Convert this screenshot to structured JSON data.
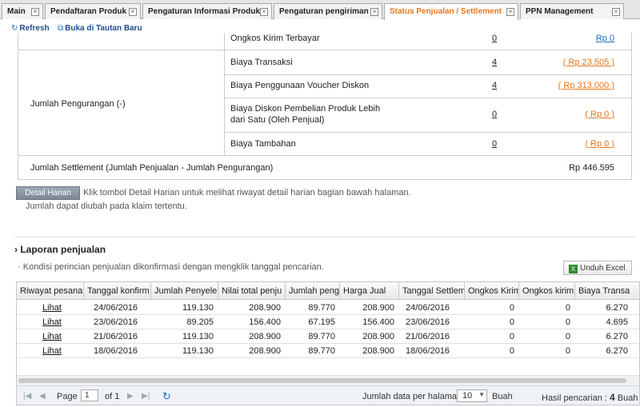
{
  "tabs": [
    {
      "label": "Main"
    },
    {
      "label": "Pendaftaran Produk"
    },
    {
      "label": "Pengaturan Informasi Produk"
    },
    {
      "label": "Pengaturan pengiriman"
    },
    {
      "label": "Status Penjualan / Settlement"
    },
    {
      "label": "PPN Management"
    }
  ],
  "toolbar": {
    "refresh": "Refresh",
    "open_new": "Buka di Tautan Baru"
  },
  "summary": {
    "group_label": "Jumlah Pengurangan (-)",
    "rows": [
      {
        "label": "Ongkos Kirim Terbayar",
        "count": "0",
        "amount": "Rp 0"
      },
      {
        "label": "Biaya Transaksi",
        "count": "4",
        "amount": "( Rp 23.505 )"
      },
      {
        "label": "Biaya Penggunaan Voucher Diskon",
        "count": "4",
        "amount": "( Rp 313.000 )"
      },
      {
        "label": "Biaya Diskon Pembelian Produk Lebih",
        "label2": "dari Satu (Oleh Penjual)",
        "count": "0",
        "amount": "( Rp 0 )"
      },
      {
        "label": "Biaya Tambahan",
        "count": "0",
        "amount": "( Rp 0 )"
      }
    ],
    "settlement_label": "Jumlah Settlement (Jumlah Penjualan - Jumlah Pengurangan)",
    "settlement_value": "Rp 446.595"
  },
  "detail_button": "Detail Harian",
  "notes": {
    "line1": "Klik tombol Detail Harian untuk melihat riwayat detail harian bagian bawah halaman.",
    "line2": "Jumlah dapat diubah pada klaim tertentu."
  },
  "report": {
    "title": "Laporan penjualan",
    "desc": "Kondisi perincian penjualan dikonfirmasi dengan mengklik tanggal pencarian.",
    "excel": "Unduh Excel",
    "columns": [
      "Riwayat pesana",
      "Tanggal konfirm",
      "Jumlah Penyele",
      "Nilai total penju",
      "Jumlah peng",
      "Harga Jual",
      "Tanggal Settlem",
      "Ongkos Kirim",
      "Ongkos kirim",
      "Biaya Transa"
    ],
    "rows": [
      [
        "Lihat",
        "24/06/2016",
        "119.130",
        "208.900",
        "89.770",
        "208.900",
        "24/06/2016",
        "0",
        "0",
        "6.270"
      ],
      [
        "Lihat",
        "23/06/2016",
        "89.205",
        "156.400",
        "67.195",
        "156.400",
        "23/06/2016",
        "0",
        "0",
        "4.695"
      ],
      [
        "Lihat",
        "21/06/2016",
        "119.130",
        "208.900",
        "89.770",
        "208.900",
        "21/06/2016",
        "0",
        "0",
        "6.270"
      ],
      [
        "Lihat",
        "18/06/2016",
        "119.130",
        "208.900",
        "89.770",
        "208.900",
        "18/06/2016",
        "0",
        "0",
        "6.270"
      ]
    ]
  },
  "pager": {
    "page_label": "Page",
    "page_value": "1",
    "of_label": "of 1",
    "per_page_label": "Jumlah data per halaman",
    "per_page_value": "10",
    "unit": "Buah",
    "result_label": "Hasil pencarian :",
    "result_count": "4",
    "result_unit": "Buah"
  }
}
